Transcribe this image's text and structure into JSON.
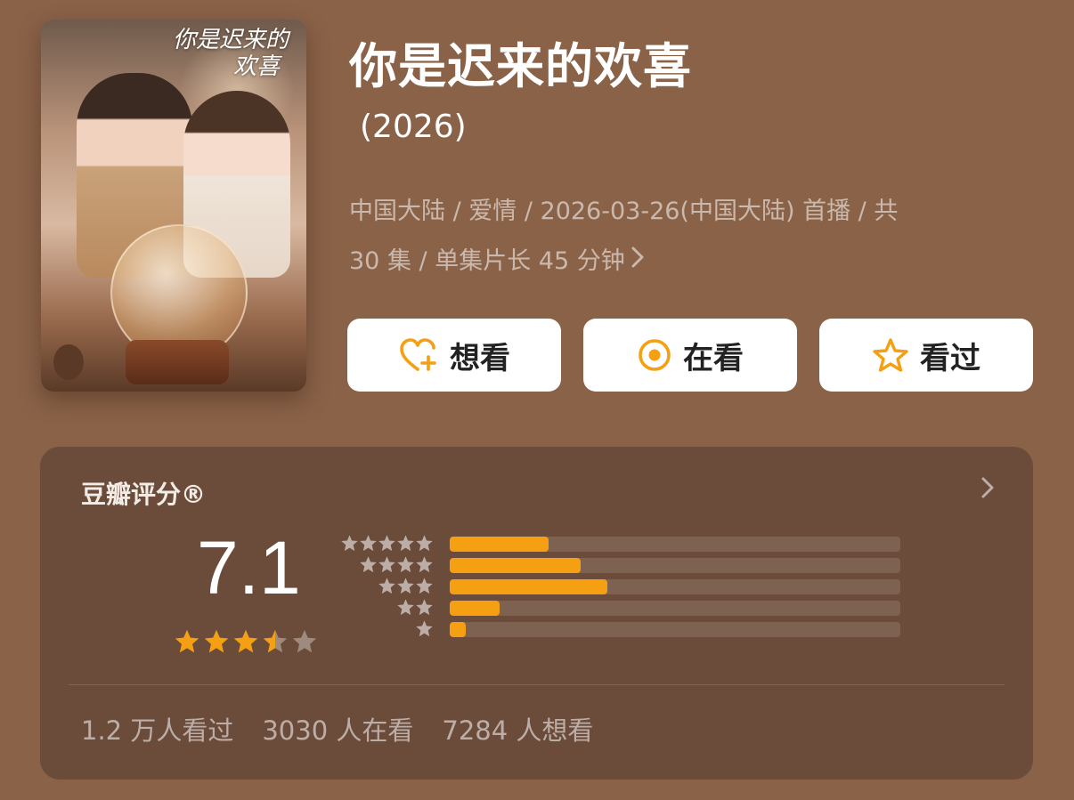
{
  "poster": {
    "title_line1": "你是迟来的",
    "title_line2": "欢喜"
  },
  "title": "你是迟来的欢喜",
  "year": "(2026)",
  "meta_line1": "中国大陆 / 爱情 / 2026-03-26(中国大陆) 首播 / 共",
  "meta_line2": "30 集 / 单集片长 45 分钟",
  "meta_more_icon": "chevron-right-icon",
  "actions": [
    {
      "label": "想看",
      "icon": "heart-plus-icon"
    },
    {
      "label": "在看",
      "icon": "target-icon"
    },
    {
      "label": "看过",
      "icon": "star-outline-icon"
    }
  ],
  "rating": {
    "header": "豆瓣评分®",
    "arrow_icon": "chevron-right-icon",
    "score": "7.1",
    "score_stars": 3.5,
    "distribution": [
      {
        "stars": 5,
        "fraction": 0.22
      },
      {
        "stars": 4,
        "fraction": 0.29
      },
      {
        "stars": 3,
        "fraction": 0.35
      },
      {
        "stars": 2,
        "fraction": 0.11
      },
      {
        "stars": 1,
        "fraction": 0.035
      }
    ]
  },
  "stats": {
    "watched": "1.2 万人看过",
    "watching": "3030 人在看",
    "wish": "7284 人想看"
  },
  "colors": {
    "background": "#8a6248",
    "card": "#6b4c3a",
    "accent": "#f4a012"
  }
}
